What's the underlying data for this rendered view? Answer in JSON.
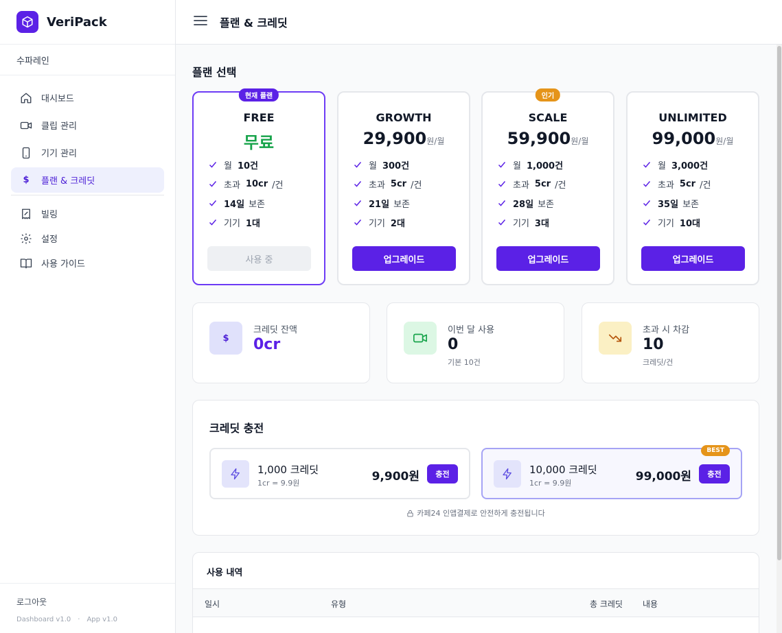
{
  "app": {
    "name": "VeriPack",
    "org": "수파레인"
  },
  "nav": {
    "items": [
      {
        "label": "대시보드",
        "icon": "home-icon"
      },
      {
        "label": "클립 관리",
        "icon": "video-icon"
      },
      {
        "label": "기기 관리",
        "icon": "phone-icon"
      },
      {
        "label": "플랜 & 크레딧",
        "icon": "dollar-icon",
        "active": true
      }
    ],
    "secondary": [
      {
        "label": "빌링",
        "icon": "receipt-icon"
      },
      {
        "label": "설정",
        "icon": "gear-icon"
      },
      {
        "label": "사용 가이드",
        "icon": "book-icon"
      }
    ],
    "logout": "로그아웃",
    "dashboard_version": "Dashboard v1.0",
    "separator": "·",
    "app_version": "App v1.0"
  },
  "header": {
    "title": "플랜 & 크레딧"
  },
  "plans_section": {
    "title": "플랜 선택"
  },
  "plans": [
    {
      "name": "FREE",
      "price": "무료",
      "unit": "",
      "badge": "현재 플랜",
      "monthly_pre": "월",
      "monthly": "10건",
      "overage_pre": "초과",
      "overage": "10cr",
      "overage_suf": "/건",
      "retention": "14일",
      "retention_suf": "보존",
      "devices_pre": "기기",
      "devices": "1대",
      "button": "사용 중"
    },
    {
      "name": "GROWTH",
      "price": "29,900",
      "unit": "원/월",
      "badge": "",
      "monthly_pre": "월",
      "monthly": "300건",
      "overage_pre": "초과",
      "overage": "5cr",
      "overage_suf": "/건",
      "retention": "21일",
      "retention_suf": "보존",
      "devices_pre": "기기",
      "devices": "2대",
      "button": "업그레이드"
    },
    {
      "name": "SCALE",
      "price": "59,900",
      "unit": "원/월",
      "badge": "인기",
      "monthly_pre": "월",
      "monthly": "1,000건",
      "overage_pre": "초과",
      "overage": "5cr",
      "overage_suf": "/건",
      "retention": "28일",
      "retention_suf": "보존",
      "devices_pre": "기기",
      "devices": "3대",
      "button": "업그레이드"
    },
    {
      "name": "UNLIMITED",
      "price": "99,000",
      "unit": "원/월",
      "badge": "",
      "monthly_pre": "월",
      "monthly": "3,000건",
      "overage_pre": "초과",
      "overage": "5cr",
      "overage_suf": "/건",
      "retention": "35일",
      "retention_suf": "보존",
      "devices_pre": "기기",
      "devices": "10대",
      "button": "업그레이드"
    }
  ],
  "stats": {
    "balance": {
      "label": "크레딧 잔액",
      "value": "0cr",
      "icon": "dollar-icon"
    },
    "usage": {
      "label": "이번 달 사용",
      "value": "0",
      "sub": "기본 10건",
      "icon": "video-icon"
    },
    "overage": {
      "label": "초과 시 차감",
      "value": "10",
      "sub": "크레딧/건",
      "icon": "trending-down-icon"
    }
  },
  "topup": {
    "title": "크레딧 충전",
    "packs": [
      {
        "name": "1,000 크레딧",
        "rate": "1cr = 9.9원",
        "price": "9,900원",
        "button": "충전",
        "badge": ""
      },
      {
        "name": "10,000 크레딧",
        "rate": "1cr = 9.9원",
        "price": "99,000원",
        "button": "충전",
        "badge": "BEST"
      }
    ],
    "note": "카페24 인앱결제로 안전하게 충전됩니다"
  },
  "history": {
    "title": "사용 내역",
    "columns": [
      "일시",
      "유형",
      "총 크레딧",
      "내용"
    ]
  },
  "colors": {
    "accent": "#5b21e6",
    "free": "#16a34a",
    "badge_orange": "#e5941a"
  }
}
